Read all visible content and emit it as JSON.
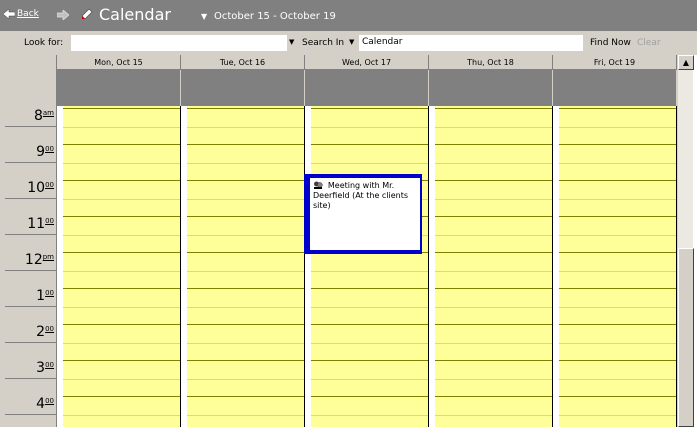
{
  "titlebar": {
    "back_label": "Back",
    "title": "Calendar",
    "date_range": "October 15 - October 19",
    "icons": [
      "back-arrow-icon",
      "forward-arrow-icon",
      "calendar-icon"
    ]
  },
  "findbar": {
    "look_for_label": "Look for:",
    "look_for_value": "",
    "search_in_label": "Search In",
    "search_in_value": "Calendar",
    "find_now_label": "Find Now",
    "clear_label": "Clear"
  },
  "days": [
    {
      "label": "Mon, Oct 15"
    },
    {
      "label": "Tue, Oct 16"
    },
    {
      "label": "Wed, Oct 17"
    },
    {
      "label": "Thu, Oct 18"
    },
    {
      "label": "Fri, Oct 19"
    }
  ],
  "hours": [
    {
      "hour": "8",
      "suffix": "am"
    },
    {
      "hour": "9",
      "suffix": "00"
    },
    {
      "hour": "10",
      "suffix": "00"
    },
    {
      "hour": "11",
      "suffix": "00"
    },
    {
      "hour": "12",
      "suffix": "pm"
    },
    {
      "hour": "1",
      "suffix": "00"
    },
    {
      "hour": "2",
      "suffix": "00"
    },
    {
      "hour": "3",
      "suffix": "00"
    },
    {
      "hour": "4",
      "suffix": "00"
    }
  ],
  "appointment": {
    "day": "Wed, Oct 17",
    "text": "Meeting with Mr. Deerfield (At the clients site)",
    "icon": "meeting-icon"
  },
  "colors": {
    "titlebar_bg": "#808080",
    "grid_bg": "#ffff99",
    "appointment_border": "#0000cc"
  }
}
